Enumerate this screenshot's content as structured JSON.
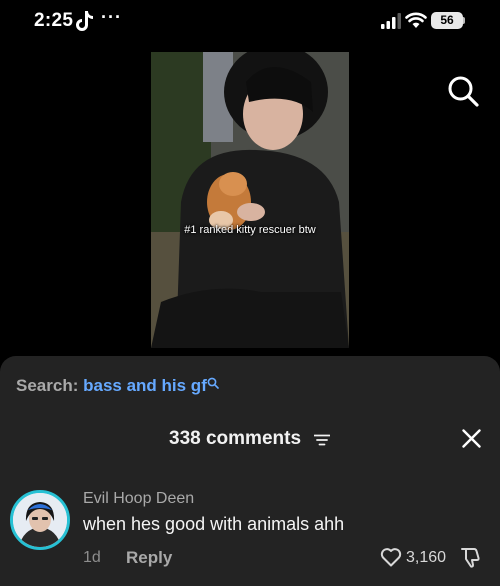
{
  "status_bar": {
    "time": "2:25",
    "more": "···",
    "battery": "56"
  },
  "video": {
    "caption": "#1 ranked kitty rescuer btw"
  },
  "comments_panel": {
    "search_label": "Search:",
    "search_query": "bass and his gf",
    "title": "338 comments"
  },
  "comment": {
    "author": "Evil Hoop Deen",
    "text": "when hes good with animals ahh",
    "age": "1d",
    "reply_label": "Reply",
    "likes": "3,160"
  },
  "colors": {
    "sheet_bg": "#232323",
    "search_query": "#66a9ff",
    "avatar_ring": "#27c1d4"
  },
  "icons": [
    "tiktok-icon",
    "signal-icon",
    "wifi-icon",
    "battery-icon",
    "search-icon",
    "filter-icon",
    "close-icon",
    "heart-icon",
    "dislike-icon"
  ]
}
